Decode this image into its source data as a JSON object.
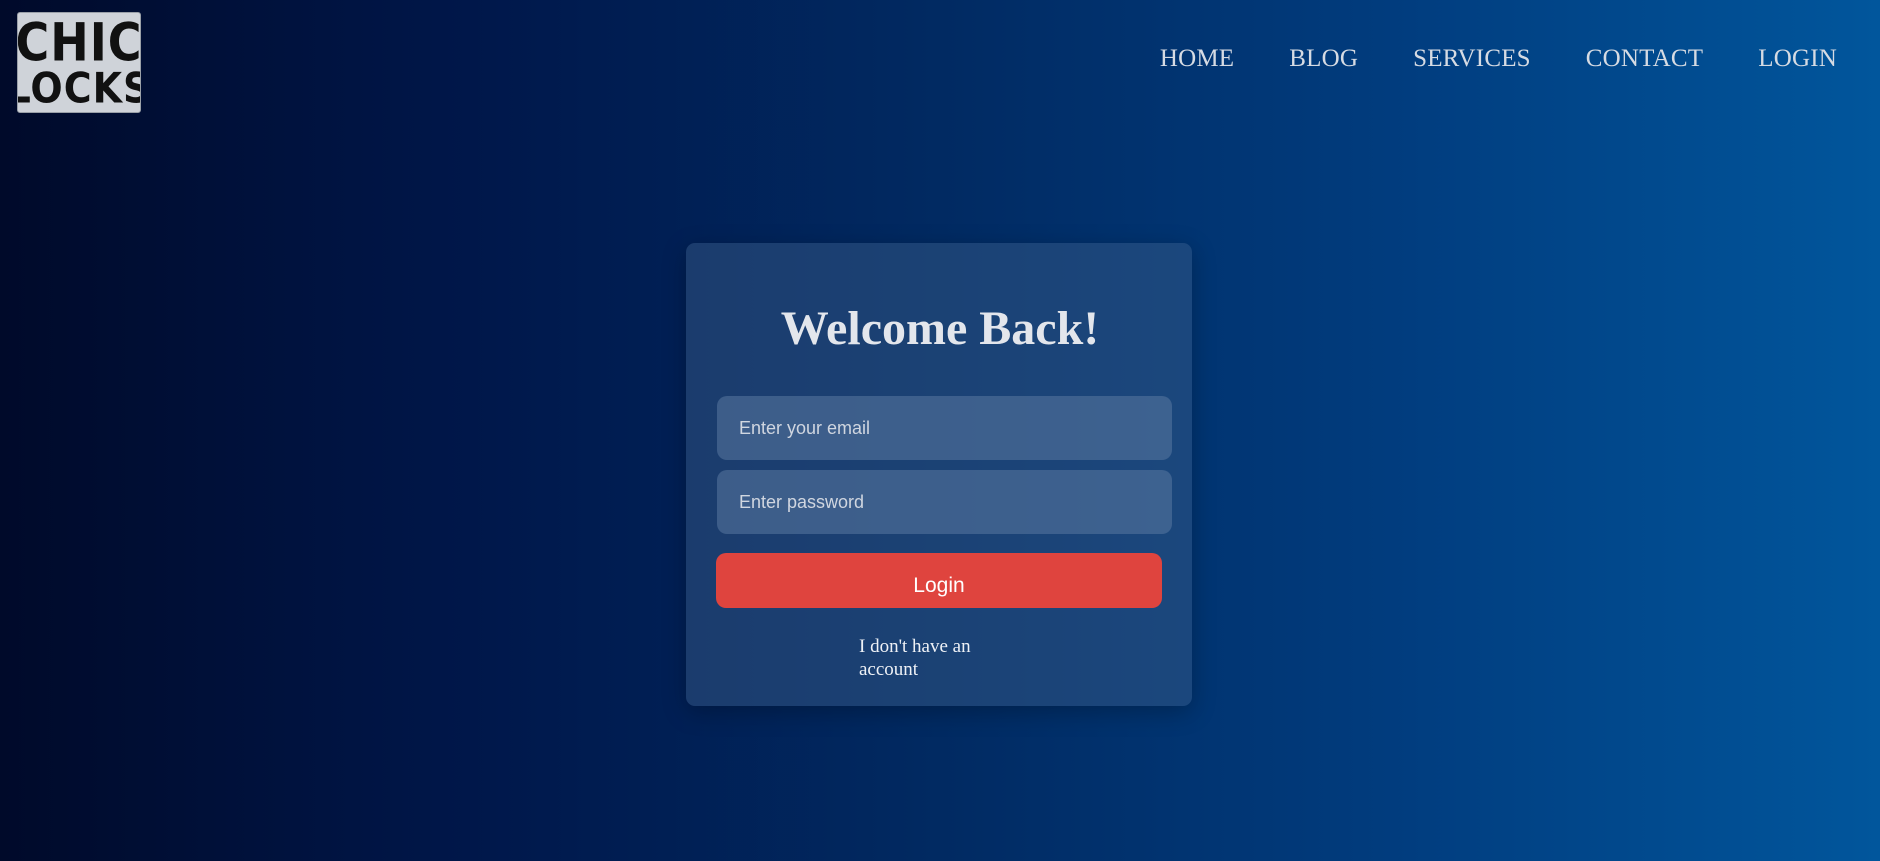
{
  "header": {
    "logo": {
      "line1": "CHIC",
      "line2": "LOCKS"
    },
    "nav": [
      "HOME",
      "BLOG",
      "SERVICES",
      "CONTACT",
      "LOGIN"
    ]
  },
  "login_card": {
    "title": "Welcome Back!",
    "email_placeholder": "Enter your email",
    "password_placeholder": "Enter password",
    "login_label": "Login",
    "signup_link": "I don't have an account"
  },
  "colors": {
    "button": "#df443e",
    "background_left": "#000a2a",
    "background_right": "#01569c"
  }
}
